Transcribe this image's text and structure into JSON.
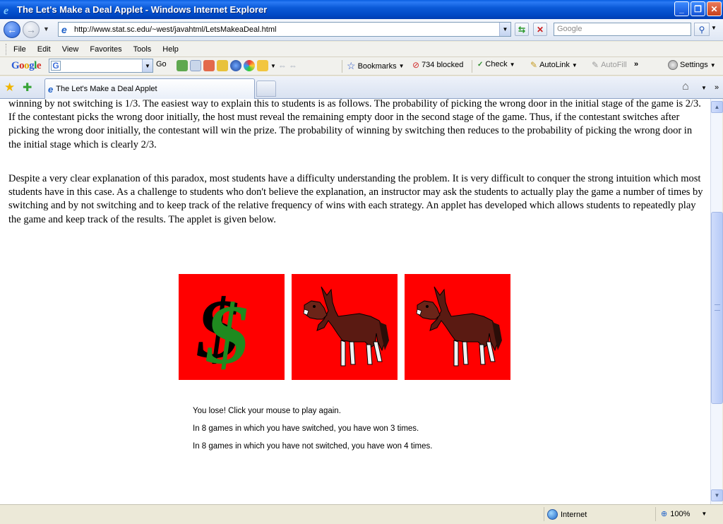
{
  "window": {
    "title": "The Let's Make a Deal Applet - Windows Internet Explorer"
  },
  "address": {
    "url": "http://www.stat.sc.edu/~west/javahtml/LetsMakeaDeal.html",
    "search_placeholder": "Google"
  },
  "menu": {
    "items": [
      "File",
      "Edit",
      "View",
      "Favorites",
      "Tools",
      "Help"
    ]
  },
  "google_toolbar": {
    "logo": "Google",
    "go_label": "Go",
    "bookmarks_label": "Bookmarks",
    "blocked_label": "734 blocked",
    "check_label": "Check",
    "autolink_label": "AutoLink",
    "autofill_label": "AutoFill",
    "more_label": "»",
    "settings_label": "Settings"
  },
  "tabs": [
    {
      "label": "The Let's Make a Deal Applet"
    }
  ],
  "content": {
    "para1": "winning by not switching is 1/3. The easiest way to explain this to students is as follows. The probability of picking the wrong door in the initial stage of the game is 2/3. If the contestant picks the wrong door initially, the host must reveal the remaining empty door in the second stage of the game. Thus, if the contestant switches after picking the wrong door initially, the contestant will win the prize. The probability of winning by switching then reduces to the probability of picking the wrong door in the initial stage which is clearly 2/3.",
    "para2": "Despite a very clear explanation of this paradox, most students have a difficulty understanding the problem. It is very difficult to conquer the strong intuition which most students have in this case. As a challenge to students who don't believe the explanation, an instructor may ask the students to actually play the game a number of times by switching and by not switching and to keep track of the relative frequency of wins with each strategy. An applet has developed which allows students to repeatedly play the game and keep track of the results. The applet is given below.",
    "applet": {
      "doors": [
        "dollar",
        "donkey",
        "donkey"
      ],
      "message": "You lose! Click your mouse to play again.",
      "switched_stats": "In 8 games in which you have switched, you have won 3 times.",
      "not_switched_stats": "In 8 games in which you have not switched, you have won 4 times."
    }
  },
  "statusbar": {
    "zone": "Internet",
    "zoom": "100%"
  },
  "colors": {
    "door_background": "#ff0000",
    "dollar_green": "#1f8a1f",
    "donkey_brown": "#5a1a12"
  }
}
